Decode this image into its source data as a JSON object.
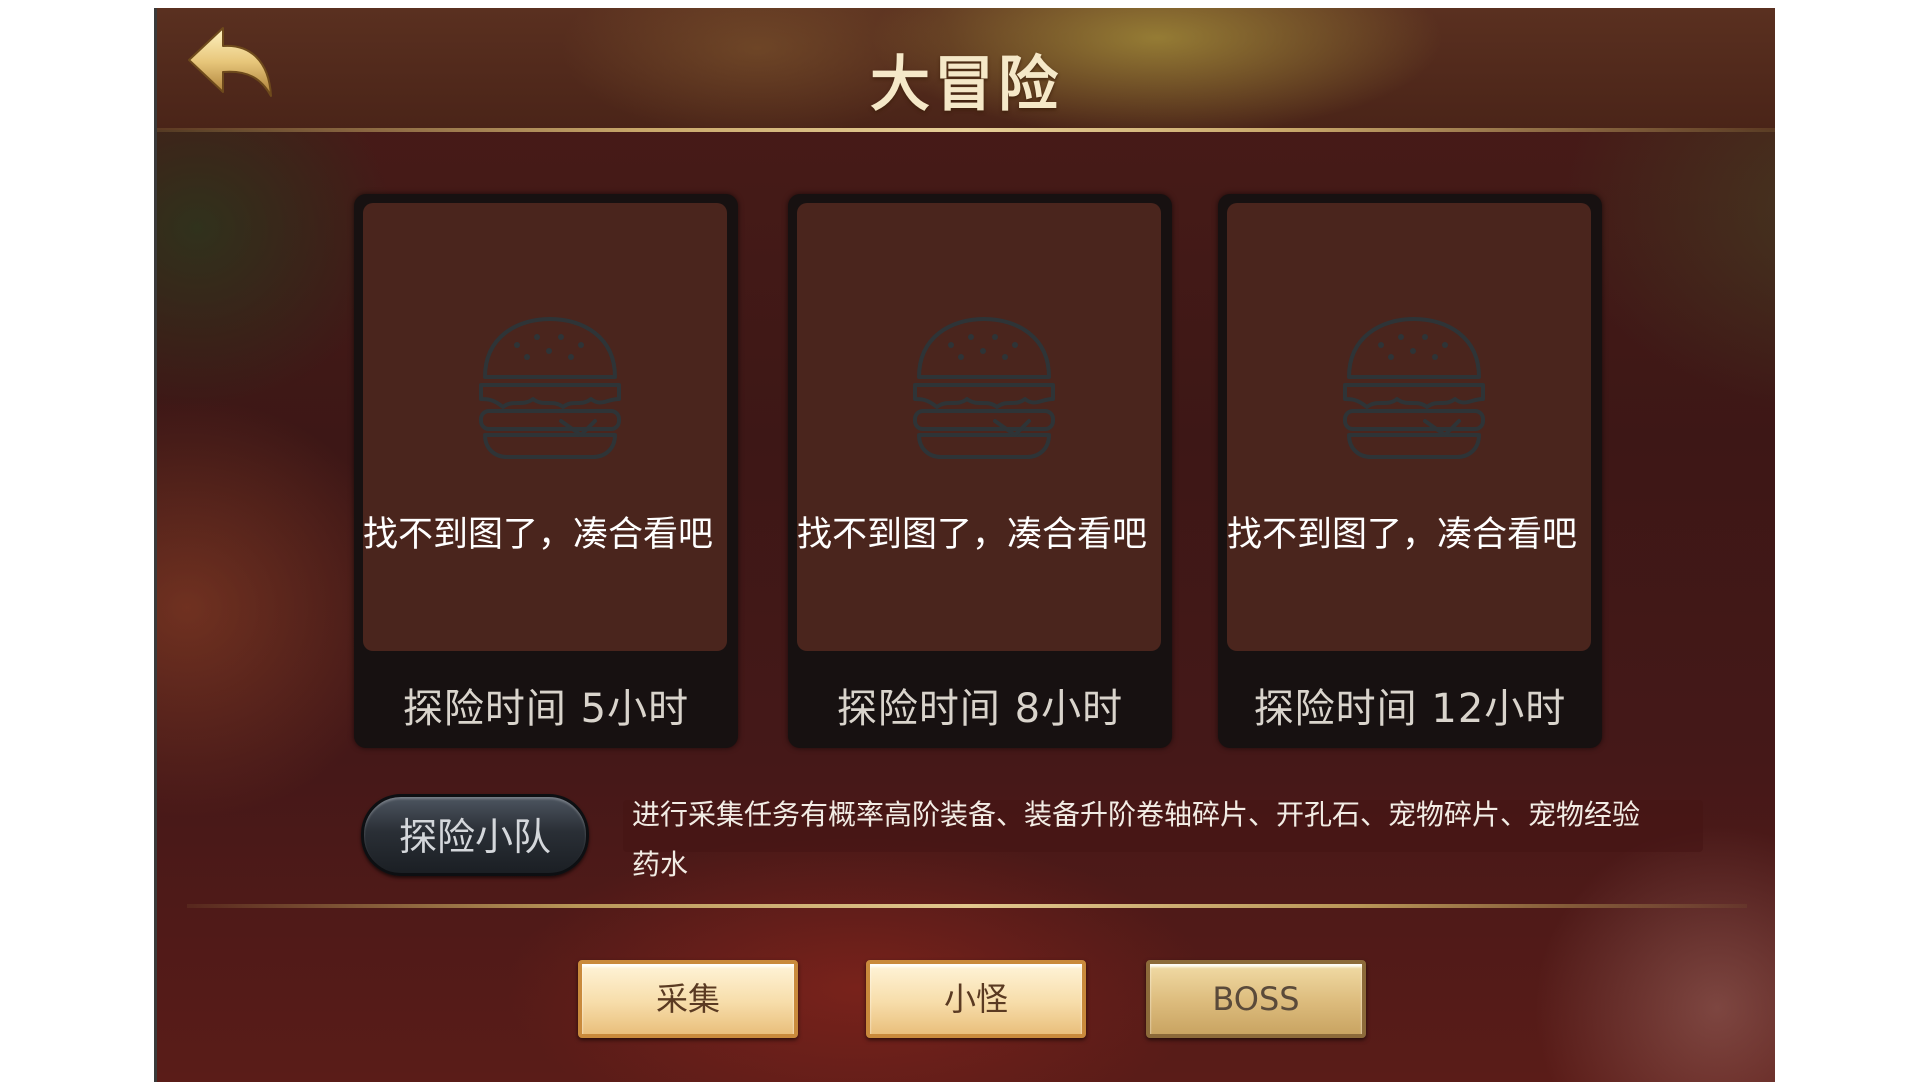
{
  "header": {
    "title": "大冒险",
    "back_icon": "back-arrow-icon"
  },
  "cards": [
    {
      "placeholder_text": "找不到图了，凑合看吧",
      "duration": "探险时间 5小时",
      "icon": "burger-icon"
    },
    {
      "placeholder_text": "找不到图了，凑合看吧",
      "duration": "探险时间 8小时",
      "icon": "burger-icon"
    },
    {
      "placeholder_text": "找不到图了，凑合看吧",
      "duration": "探险时间 12小时",
      "icon": "burger-icon"
    }
  ],
  "team_button": {
    "label": "探险小队"
  },
  "description": "进行采集任务有概率高阶装备、装备升阶卷轴碎片、开孔石、宠物碎片、宠物经验药水",
  "tabs": [
    {
      "label": "采集",
      "active": false
    },
    {
      "label": "小怪",
      "active": false
    },
    {
      "label": "BOSS",
      "active": true
    }
  ],
  "colors": {
    "title_text": "#f5e8c8",
    "card_bg": "#4a251d",
    "tab_gold": "#f7ddaa",
    "accent_rule": "#e7cf98"
  }
}
